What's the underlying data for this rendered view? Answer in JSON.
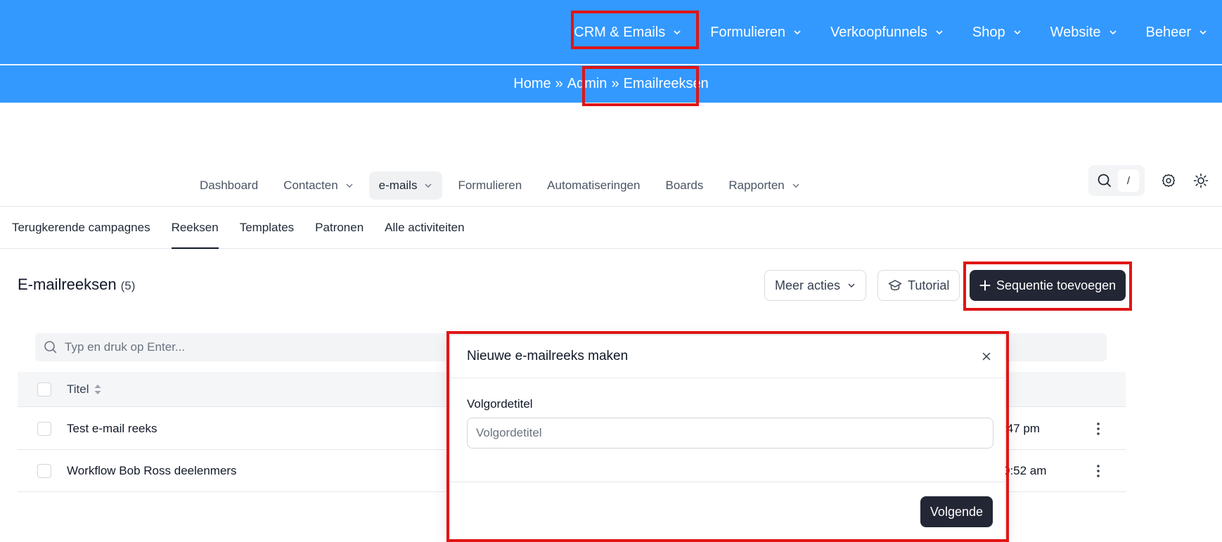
{
  "top_nav": {
    "items": [
      {
        "label": "CRM & Emails"
      },
      {
        "label": "Formulieren"
      },
      {
        "label": "Verkoopfunnels"
      },
      {
        "label": "Shop"
      },
      {
        "label": "Website"
      },
      {
        "label": "Beheer"
      }
    ]
  },
  "breadcrumb": {
    "home": "Home",
    "sep1": "»",
    "admin": "Admin",
    "sep2": "»",
    "current": "Emailreeksen"
  },
  "sub_nav": {
    "items": [
      {
        "label": "Dashboard"
      },
      {
        "label": "Contacten"
      },
      {
        "label": "e-mails"
      },
      {
        "label": "Formulieren"
      },
      {
        "label": "Automatiseringen"
      },
      {
        "label": "Boards"
      },
      {
        "label": "Rapporten"
      }
    ],
    "search_shortcut": "/"
  },
  "tabs": [
    {
      "label": "Terugkerende campagnes"
    },
    {
      "label": "Reeksen"
    },
    {
      "label": "Templates"
    },
    {
      "label": "Patronen"
    },
    {
      "label": "Alle activiteiten"
    }
  ],
  "page": {
    "title": "E-mailreeksen",
    "count": "(5)",
    "more_actions": "Meer acties",
    "tutorial": "Tutorial",
    "add_sequence": "Sequentie toevoegen"
  },
  "table": {
    "search_placeholder": "Typ en druk op Enter...",
    "column_title": "Titel",
    "rows": [
      {
        "title": "Test e-mail reeks",
        "date_fragment": ":47 pm"
      },
      {
        "title": "Workflow Bob Ross deelenmers",
        "date_fragment": "0:52 am"
      }
    ]
  },
  "modal": {
    "title": "Nieuwe e-mailreeks maken",
    "close": "×",
    "field_label": "Volgordetitel",
    "field_placeholder": "Volgordetitel",
    "field_value": "",
    "next": "Volgende"
  },
  "colors": {
    "topbar": "#3399ff",
    "dark_button": "#232634",
    "highlight": "#e01515"
  }
}
